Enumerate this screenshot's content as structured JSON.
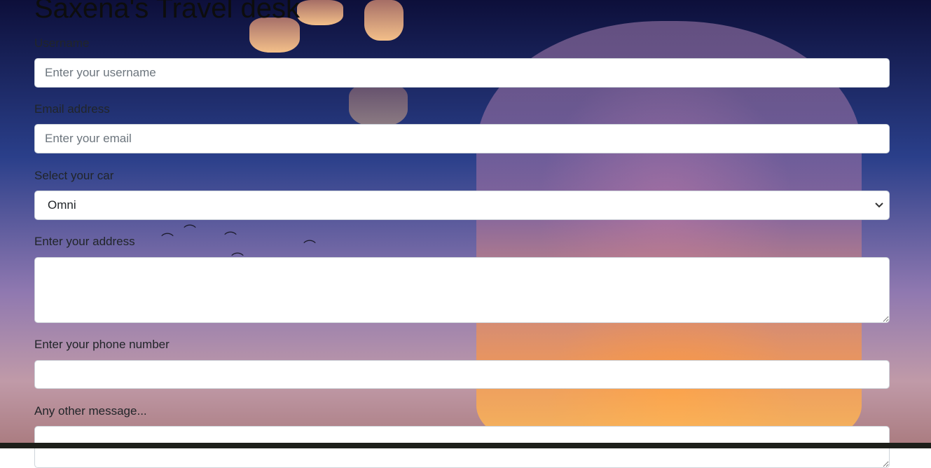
{
  "title": "Saxena's Travel desk",
  "fields": {
    "username": {
      "label": "Username",
      "placeholder": "Enter your username"
    },
    "email": {
      "label": "Email address",
      "placeholder": "Enter your email"
    },
    "car": {
      "label": "Select your car",
      "selected": "Omni"
    },
    "address": {
      "label": "Enter your address"
    },
    "phone": {
      "label": "Enter your phone number"
    },
    "message": {
      "label": "Any other message..."
    }
  },
  "icons": {
    "select_chevron": "chevron-down-icon"
  },
  "colors": {
    "input_border": "#ced4da",
    "text": "#212529",
    "placeholder": "#6c757d"
  }
}
